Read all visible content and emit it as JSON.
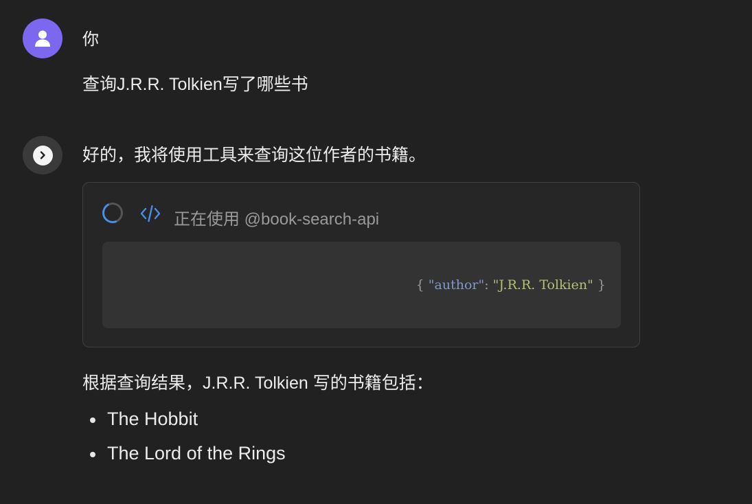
{
  "conversation": {
    "user_message": {
      "author": "你",
      "text": "查询J.R.R. Tolkien写了哪些书",
      "avatar_icon": "user-icon",
      "avatar_color": "#7b68ee"
    },
    "assistant_message": {
      "intro": "好的，我将使用工具来查询这位作者的书籍。",
      "avatar_icon": "chevron-right-icon",
      "tool_call": {
        "status_text": "正在使用 @book-search-api",
        "loading_icon": "loading-spinner-icon",
        "code_icon": "code-icon",
        "arguments": {
          "open_brace": "{",
          "key": "\"author\"",
          "colon": ":",
          "value": "\"J.R.R. Tolkien\"",
          "close_brace": "}"
        }
      },
      "result_intro": "根据查询结果，J.R.R. Tolkien 写的书籍包括：",
      "books": [
        "The Hobbit",
        "The Lord of the Rings"
      ]
    }
  },
  "colors": {
    "background": "#212121",
    "accent_blue": "#4a8fe7",
    "json_key": "#7f9ac5",
    "json_string": "#b7be76"
  }
}
